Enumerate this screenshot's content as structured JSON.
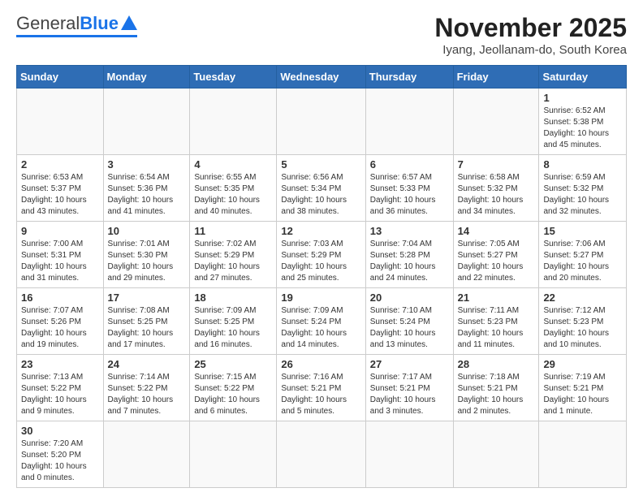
{
  "logo": {
    "general": "General",
    "blue": "Blue"
  },
  "title": "November 2025",
  "subtitle": "Iyang, Jeollanam-do, South Korea",
  "weekdays": [
    "Sunday",
    "Monday",
    "Tuesday",
    "Wednesday",
    "Thursday",
    "Friday",
    "Saturday"
  ],
  "weeks": [
    [
      {
        "day": "",
        "info": ""
      },
      {
        "day": "",
        "info": ""
      },
      {
        "day": "",
        "info": ""
      },
      {
        "day": "",
        "info": ""
      },
      {
        "day": "",
        "info": ""
      },
      {
        "day": "",
        "info": ""
      },
      {
        "day": "1",
        "info": "Sunrise: 6:52 AM\nSunset: 5:38 PM\nDaylight: 10 hours\nand 45 minutes."
      }
    ],
    [
      {
        "day": "2",
        "info": "Sunrise: 6:53 AM\nSunset: 5:37 PM\nDaylight: 10 hours\nand 43 minutes."
      },
      {
        "day": "3",
        "info": "Sunrise: 6:54 AM\nSunset: 5:36 PM\nDaylight: 10 hours\nand 41 minutes."
      },
      {
        "day": "4",
        "info": "Sunrise: 6:55 AM\nSunset: 5:35 PM\nDaylight: 10 hours\nand 40 minutes."
      },
      {
        "day": "5",
        "info": "Sunrise: 6:56 AM\nSunset: 5:34 PM\nDaylight: 10 hours\nand 38 minutes."
      },
      {
        "day": "6",
        "info": "Sunrise: 6:57 AM\nSunset: 5:33 PM\nDaylight: 10 hours\nand 36 minutes."
      },
      {
        "day": "7",
        "info": "Sunrise: 6:58 AM\nSunset: 5:32 PM\nDaylight: 10 hours\nand 34 minutes."
      },
      {
        "day": "8",
        "info": "Sunrise: 6:59 AM\nSunset: 5:32 PM\nDaylight: 10 hours\nand 32 minutes."
      }
    ],
    [
      {
        "day": "9",
        "info": "Sunrise: 7:00 AM\nSunset: 5:31 PM\nDaylight: 10 hours\nand 31 minutes."
      },
      {
        "day": "10",
        "info": "Sunrise: 7:01 AM\nSunset: 5:30 PM\nDaylight: 10 hours\nand 29 minutes."
      },
      {
        "day": "11",
        "info": "Sunrise: 7:02 AM\nSunset: 5:29 PM\nDaylight: 10 hours\nand 27 minutes."
      },
      {
        "day": "12",
        "info": "Sunrise: 7:03 AM\nSunset: 5:29 PM\nDaylight: 10 hours\nand 25 minutes."
      },
      {
        "day": "13",
        "info": "Sunrise: 7:04 AM\nSunset: 5:28 PM\nDaylight: 10 hours\nand 24 minutes."
      },
      {
        "day": "14",
        "info": "Sunrise: 7:05 AM\nSunset: 5:27 PM\nDaylight: 10 hours\nand 22 minutes."
      },
      {
        "day": "15",
        "info": "Sunrise: 7:06 AM\nSunset: 5:27 PM\nDaylight: 10 hours\nand 20 minutes."
      }
    ],
    [
      {
        "day": "16",
        "info": "Sunrise: 7:07 AM\nSunset: 5:26 PM\nDaylight: 10 hours\nand 19 minutes."
      },
      {
        "day": "17",
        "info": "Sunrise: 7:08 AM\nSunset: 5:25 PM\nDaylight: 10 hours\nand 17 minutes."
      },
      {
        "day": "18",
        "info": "Sunrise: 7:09 AM\nSunset: 5:25 PM\nDaylight: 10 hours\nand 16 minutes."
      },
      {
        "day": "19",
        "info": "Sunrise: 7:09 AM\nSunset: 5:24 PM\nDaylight: 10 hours\nand 14 minutes."
      },
      {
        "day": "20",
        "info": "Sunrise: 7:10 AM\nSunset: 5:24 PM\nDaylight: 10 hours\nand 13 minutes."
      },
      {
        "day": "21",
        "info": "Sunrise: 7:11 AM\nSunset: 5:23 PM\nDaylight: 10 hours\nand 11 minutes."
      },
      {
        "day": "22",
        "info": "Sunrise: 7:12 AM\nSunset: 5:23 PM\nDaylight: 10 hours\nand 10 minutes."
      }
    ],
    [
      {
        "day": "23",
        "info": "Sunrise: 7:13 AM\nSunset: 5:22 PM\nDaylight: 10 hours\nand 9 minutes."
      },
      {
        "day": "24",
        "info": "Sunrise: 7:14 AM\nSunset: 5:22 PM\nDaylight: 10 hours\nand 7 minutes."
      },
      {
        "day": "25",
        "info": "Sunrise: 7:15 AM\nSunset: 5:22 PM\nDaylight: 10 hours\nand 6 minutes."
      },
      {
        "day": "26",
        "info": "Sunrise: 7:16 AM\nSunset: 5:21 PM\nDaylight: 10 hours\nand 5 minutes."
      },
      {
        "day": "27",
        "info": "Sunrise: 7:17 AM\nSunset: 5:21 PM\nDaylight: 10 hours\nand 3 minutes."
      },
      {
        "day": "28",
        "info": "Sunrise: 7:18 AM\nSunset: 5:21 PM\nDaylight: 10 hours\nand 2 minutes."
      },
      {
        "day": "29",
        "info": "Sunrise: 7:19 AM\nSunset: 5:21 PM\nDaylight: 10 hours\nand 1 minute."
      }
    ],
    [
      {
        "day": "30",
        "info": "Sunrise: 7:20 AM\nSunset: 5:20 PM\nDaylight: 10 hours\nand 0 minutes."
      },
      {
        "day": "",
        "info": ""
      },
      {
        "day": "",
        "info": ""
      },
      {
        "day": "",
        "info": ""
      },
      {
        "day": "",
        "info": ""
      },
      {
        "day": "",
        "info": ""
      },
      {
        "day": "",
        "info": ""
      }
    ]
  ]
}
